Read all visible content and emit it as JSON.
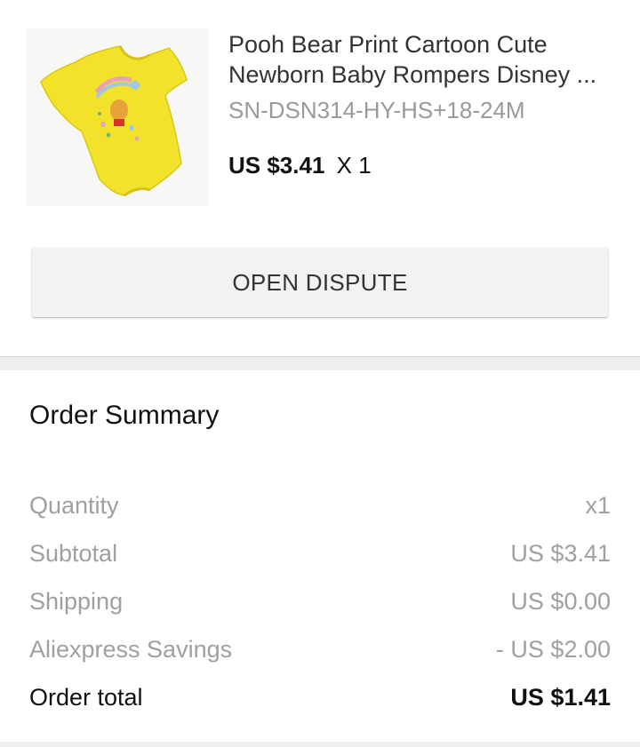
{
  "product": {
    "title_line1": "Pooh Bear Print Cartoon Cute",
    "title_line2": "Newborn Baby Rompers Disney ...",
    "sku": "SN-DSN314-HY-HS+18-24M",
    "price": "US $3.41",
    "quantity": "X 1",
    "image_icon": "yellow-baby-romper-image",
    "image_color": "#f2e22a"
  },
  "actions": {
    "open_dispute_label": "OPEN DISPUTE"
  },
  "order_summary": {
    "title": "Order Summary",
    "rows": [
      {
        "label": "Quantity",
        "value": "x1"
      },
      {
        "label": "Subtotal",
        "value": "US $3.41"
      },
      {
        "label": "Shipping",
        "value": "US $0.00"
      },
      {
        "label": "Aliexpress Savings",
        "value": "- US $2.00"
      }
    ],
    "total": {
      "label": "Order total",
      "value": "US $1.41"
    }
  },
  "colors": {
    "primary_text": "#111111",
    "secondary_text": "#a0a0a0",
    "button_background": "#f2f2f2",
    "divider": "#eeeeee"
  }
}
